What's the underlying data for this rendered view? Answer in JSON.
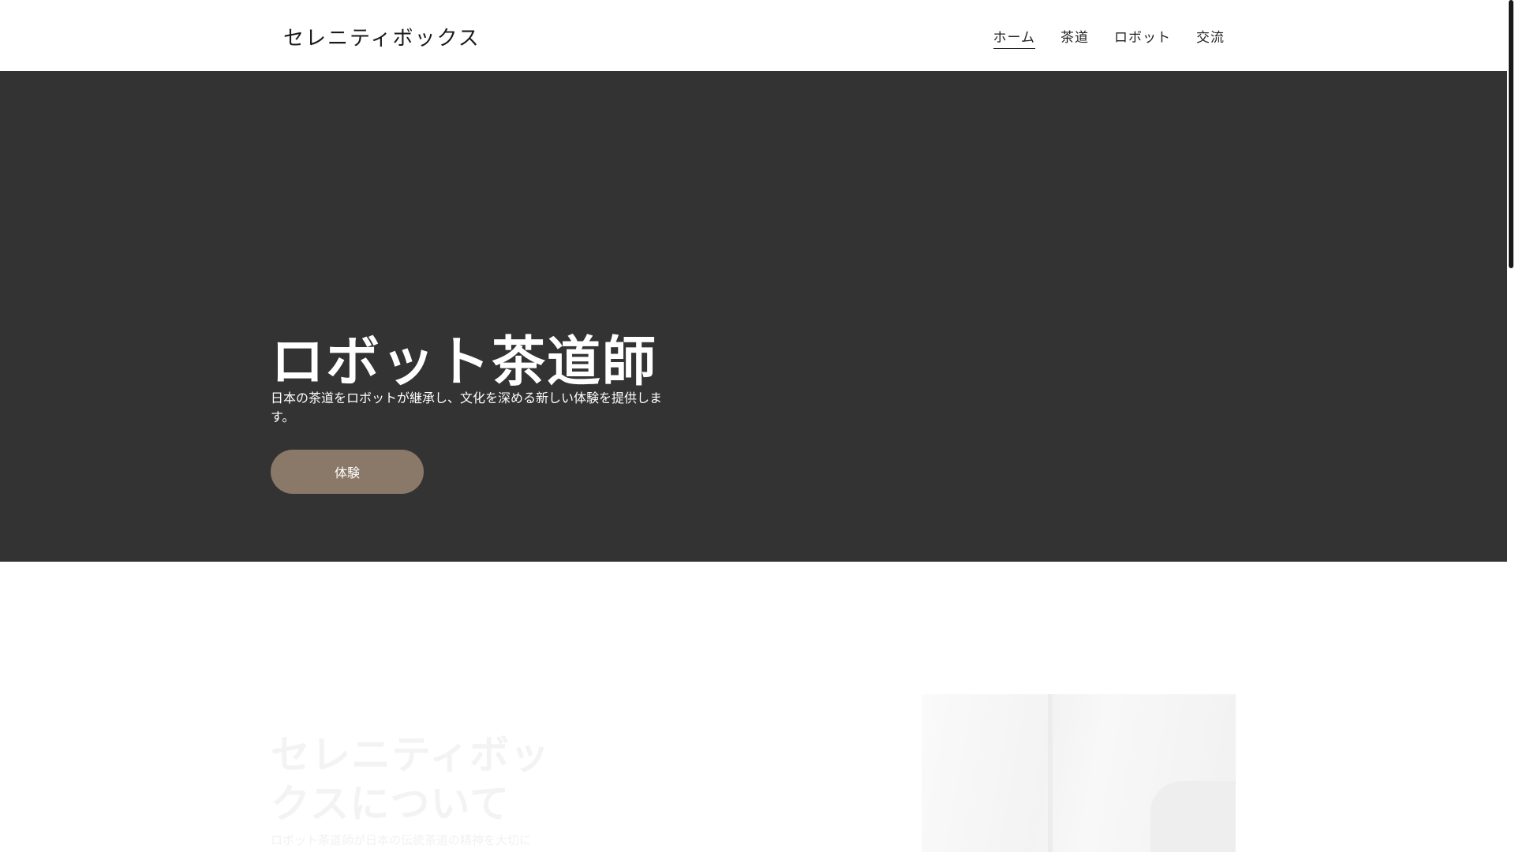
{
  "header": {
    "brand": "セレニティボックス",
    "nav": [
      {
        "label": "ホーム",
        "active": true
      },
      {
        "label": "茶道",
        "active": false
      },
      {
        "label": "ロボット",
        "active": false
      },
      {
        "label": "交流",
        "active": false
      }
    ]
  },
  "hero": {
    "title": "ロボット茶道師",
    "description": "日本の茶道をロボットが継承し、文化を深める新しい体験を提供します。",
    "button_label": "体験",
    "background_color": "#333333",
    "button_color": "#8a7868"
  },
  "about": {
    "title": "セレニティボックスについて",
    "text": "ロボット茶道師が日本の伝統茶道の精神を大切に"
  }
}
